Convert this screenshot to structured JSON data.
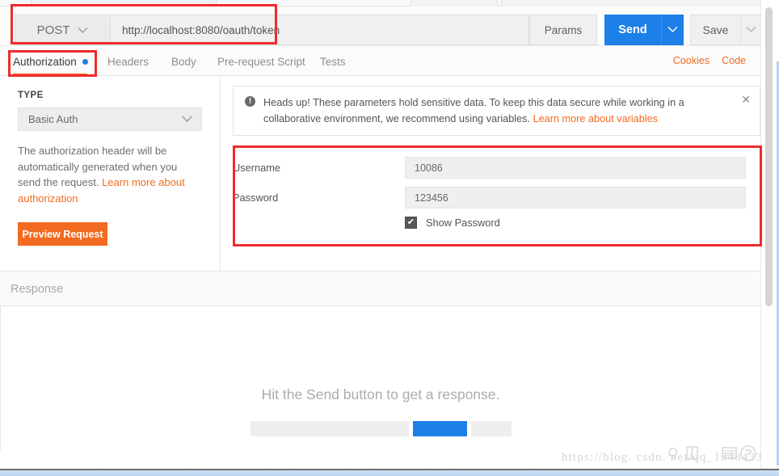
{
  "request": {
    "method": "POST",
    "method_caret": "chevron-down",
    "url": "http://localhost:8080/oauth/token",
    "params_label": "Params",
    "send_label": "Send",
    "save_label": "Save"
  },
  "tabs": [
    {
      "label": "Authorization",
      "active": true,
      "has_dot": true
    },
    {
      "label": "Headers",
      "active": false,
      "has_dot": false
    },
    {
      "label": "Body",
      "active": false,
      "has_dot": false
    },
    {
      "label": "Pre-request Script",
      "active": false,
      "has_dot": false
    },
    {
      "label": "Tests",
      "active": false,
      "has_dot": false
    }
  ],
  "tab_links": {
    "cookies": "Cookies",
    "code": "Code"
  },
  "auth": {
    "type_label": "TYPE",
    "type_value": "Basic Auth",
    "description_text": "The authorization header will be automatically generated when you send the request. ",
    "description_link": "Learn more about authorization",
    "preview_button": "Preview Request"
  },
  "notice": {
    "icon": "exclamation-circle-icon",
    "text": "Heads up! These parameters hold sensitive data. To keep this data secure while working in a collaborative environment, we recommend using variables. ",
    "link": "Learn more about variables",
    "close": "✕"
  },
  "credentials": {
    "username_label": "Username",
    "username_value": "10086",
    "password_label": "Password",
    "password_value": "123456",
    "show_password_label": "Show Password",
    "show_password_checked": true,
    "checkmark": "✔"
  },
  "response": {
    "header_label": "Response",
    "empty_message": "Hit the Send button to get a response."
  },
  "watermark": {
    "text": "https://blog. csdn. net/qq_1348433"
  },
  "colors": {
    "accent_blue": "#1d7fe8",
    "accent_orange": "#f26b21",
    "annotation_red": "#f02b2b",
    "text_muted": "#8e8e8e"
  }
}
